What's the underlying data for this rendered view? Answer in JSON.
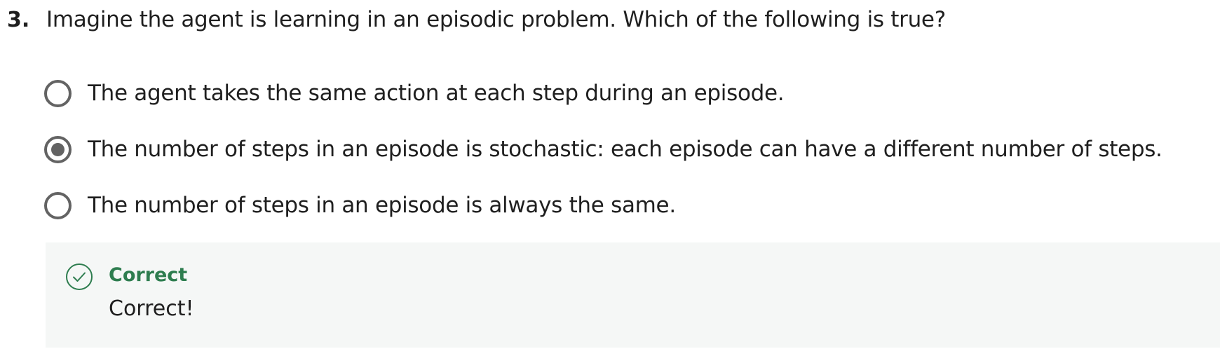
{
  "question": {
    "number": "3.",
    "text": "Imagine the agent is learning in an episodic problem. Which of the following is true?"
  },
  "options": [
    {
      "label": "The agent takes the same action at each step during an episode.",
      "selected": false
    },
    {
      "label": "The number of steps in an episode is stochastic: each episode can have a different number of steps.",
      "selected": true
    },
    {
      "label": "The number of steps in an episode is always the same.",
      "selected": false
    }
  ],
  "feedback": {
    "icon": "check-circle-icon",
    "title": "Correct",
    "message": "Correct!"
  },
  "colors": {
    "correct": "#2e7d4f",
    "radio": "#636363",
    "feedback_bg": "#f5f7f6"
  }
}
